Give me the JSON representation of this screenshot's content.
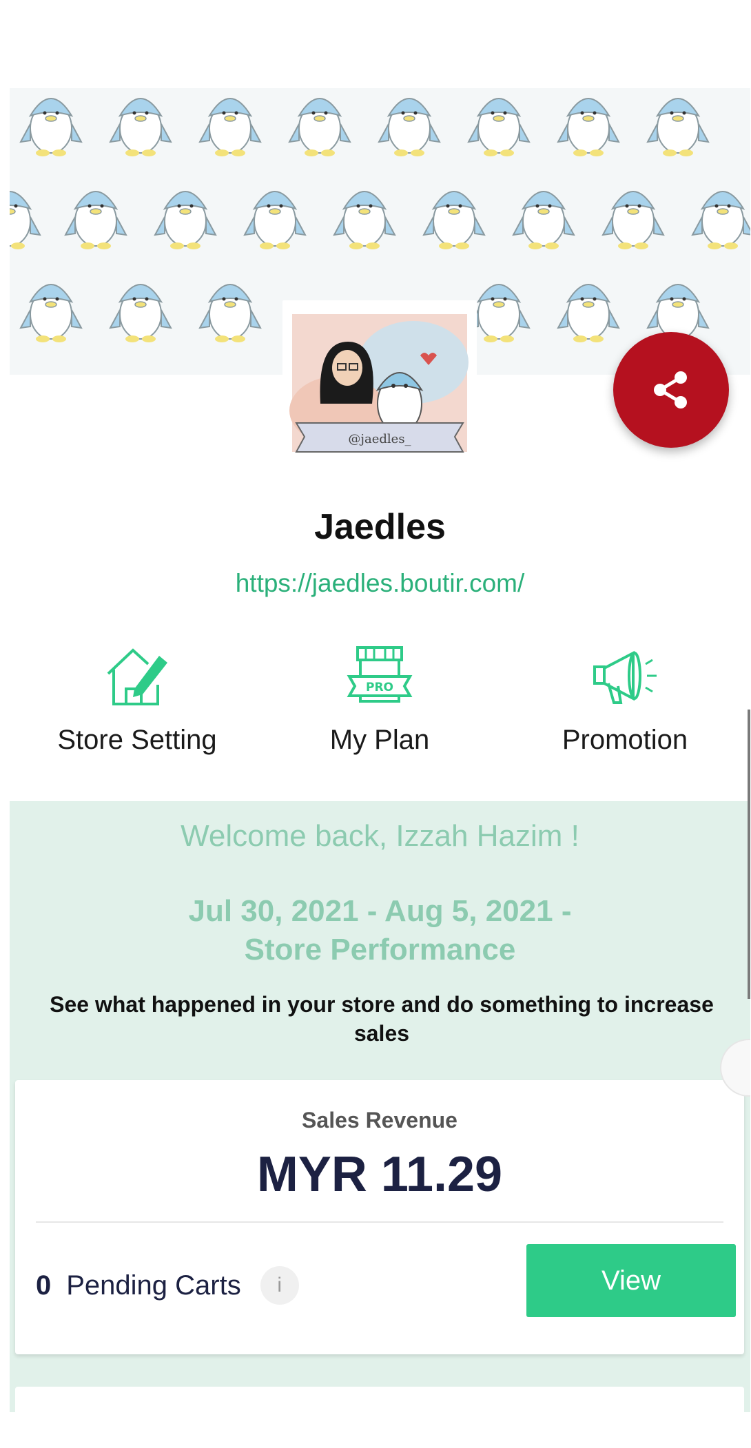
{
  "store": {
    "name": "Jaedles",
    "url": "https://jaedles.boutir.com/",
    "avatar_caption": "@jaedles_"
  },
  "actions": [
    {
      "label": "Store Setting",
      "icon": "house-pencil-icon"
    },
    {
      "label": "My Plan",
      "icon": "pro-storefront-icon",
      "badge": "PRO"
    },
    {
      "label": "Promotion",
      "icon": "megaphone-icon"
    }
  ],
  "dashboard": {
    "welcome": "Welcome back, Izzah Hazim !",
    "period_line1": "Jul 30, 2021 - Aug 5, 2021 -",
    "period_line2": "Store Performance",
    "hint": "See what happened in your store and do something to increase sales",
    "revenue_title": "Sales Revenue",
    "revenue_value": "MYR  11.29",
    "pending_count": "0",
    "pending_label": "Pending Carts",
    "info_glyph": "i",
    "view_label": "View"
  },
  "colors": {
    "accent": "#2ecb88",
    "link": "#2bb07a",
    "share": "#b5111f",
    "panel": "#e1f1ea",
    "muted_green": "#8ccbb0",
    "navy": "#1c2142"
  }
}
